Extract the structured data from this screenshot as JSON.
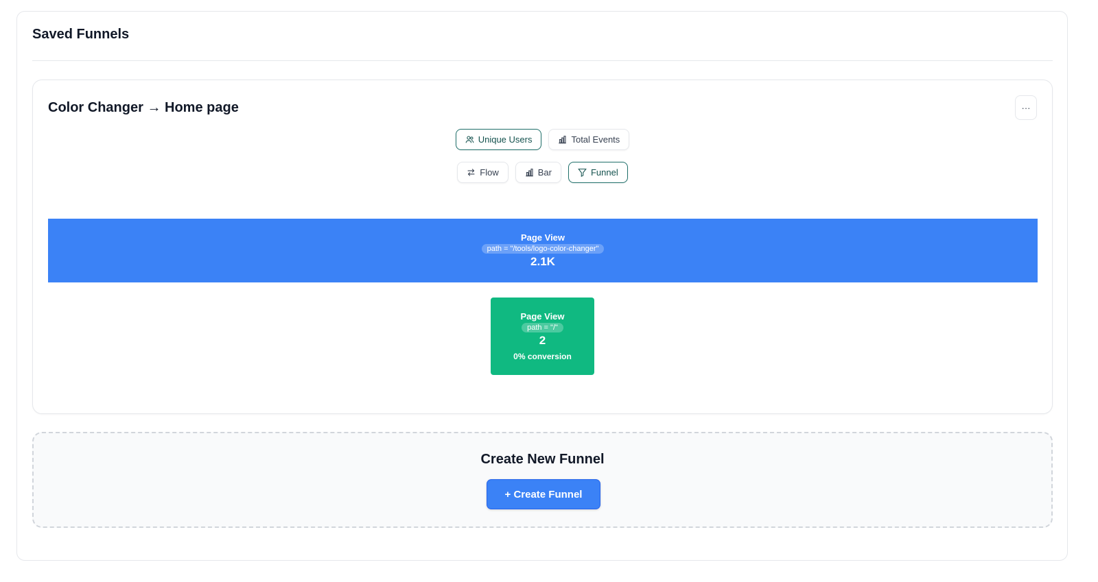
{
  "section": {
    "title": "Saved Funnels"
  },
  "funnel": {
    "title": "Color Changer → Home page",
    "more_label": "···",
    "metric_toggles": [
      {
        "label": "Unique Users",
        "icon": "users-icon",
        "active": true
      },
      {
        "label": "Total Events",
        "icon": "bar-chart-icon",
        "active": false
      }
    ],
    "view_toggles": [
      {
        "label": "Flow",
        "icon": "arrows-swap-icon",
        "active": false
      },
      {
        "label": "Bar",
        "icon": "bar-chart-icon",
        "active": false
      },
      {
        "label": "Funnel",
        "icon": "funnel-icon",
        "active": true
      }
    ],
    "steps": [
      {
        "name": "Page View",
        "filter": "path = \"/tools/logo-color-changer\"",
        "value": "2.1K",
        "color": "#3b82f6"
      },
      {
        "name": "Page View",
        "filter": "path = \"/\"",
        "value": "2",
        "conversion": "0% conversion",
        "color": "#10b981"
      }
    ]
  },
  "create": {
    "title": "Create New Funnel",
    "button_label": "+ Create Funnel"
  },
  "colors": {
    "accent": "#3b82f6",
    "success": "#10b981",
    "active_border": "#1f6f6a"
  }
}
